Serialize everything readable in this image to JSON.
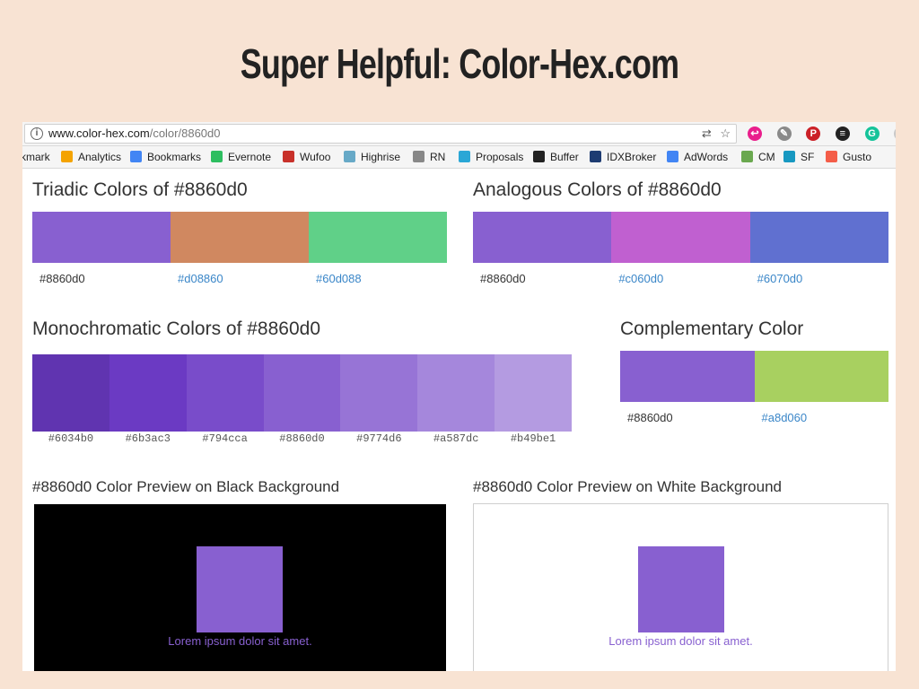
{
  "slide_title": "Super Helpful: Color-Hex.com",
  "browser": {
    "url_host": "www.color-hex.com",
    "url_path": "/color/8860d0",
    "bookmarks": [
      {
        "label": "kmark",
        "icon": "bookmark-icon",
        "color": "#777777"
      },
      {
        "label": "Analytics",
        "icon": "analytics-icon",
        "color": "#f4a300"
      },
      {
        "label": "Bookmarks",
        "icon": "google-icon",
        "color": "#4285f4"
      },
      {
        "label": "Evernote",
        "icon": "evernote-icon",
        "color": "#2dbe60"
      },
      {
        "label": "Wufoo",
        "icon": "wufoo-icon",
        "color": "#c8312a"
      },
      {
        "label": "Highrise",
        "icon": "highrise-icon",
        "color": "#67a9c7"
      },
      {
        "label": "RN",
        "icon": "rn-icon",
        "color": "#888888"
      },
      {
        "label": "Proposals",
        "icon": "proposals-icon",
        "color": "#2aa7d6"
      },
      {
        "label": "Buffer",
        "icon": "buffer-icon",
        "color": "#222222"
      },
      {
        "label": "IDXBroker",
        "icon": "idxbroker-icon",
        "color": "#1e3c72"
      },
      {
        "label": "AdWords",
        "icon": "adwords-icon",
        "color": "#4285f4"
      },
      {
        "label": "CM",
        "icon": "cm-icon",
        "color": "#6aa84f"
      },
      {
        "label": "SF",
        "icon": "salesforce-icon",
        "color": "#1798c1"
      },
      {
        "label": "Gusto",
        "icon": "gusto-icon",
        "color": "#f45d48"
      }
    ]
  },
  "triadic": {
    "title": "Triadic Colors of #8860d0",
    "colors": [
      "#8860d0",
      "#d08860",
      "#60d088"
    ],
    "labels": [
      "#8860d0",
      "#d08860",
      "#60d088"
    ]
  },
  "analogous": {
    "title": "Analogous Colors of #8860d0",
    "colors": [
      "#8860d0",
      "#c060d0",
      "#6070d0"
    ],
    "labels": [
      "#8860d0",
      "#c060d0",
      "#6070d0"
    ]
  },
  "monochromatic": {
    "title": "Monochromatic Colors of #8860d0",
    "colors": [
      "#6034b0",
      "#6b3ac3",
      "#794cca",
      "#8860d0",
      "#9774d6",
      "#a587dc",
      "#b49be1"
    ],
    "labels": [
      "#6034b0",
      "#6b3ac3",
      "#794cca",
      "#8860d0",
      "#9774d6",
      "#a587dc",
      "#b49be1"
    ]
  },
  "complementary": {
    "title": "Complementary Color",
    "colors": [
      "#8860d0",
      "#a8d060"
    ],
    "labels": [
      "#8860d0",
      "#a8d060"
    ]
  },
  "preview_black": {
    "title": "#8860d0 Color Preview on Black Background",
    "lorem": "Lorem ipsum dolor sit amet.",
    "bg": "#000000",
    "color": "#8860d0"
  },
  "preview_white": {
    "title": "#8860d0 Color Preview on White Background",
    "lorem": "Lorem ipsum dolor sit amet.",
    "bg": "#ffffff",
    "color": "#8860d0"
  }
}
